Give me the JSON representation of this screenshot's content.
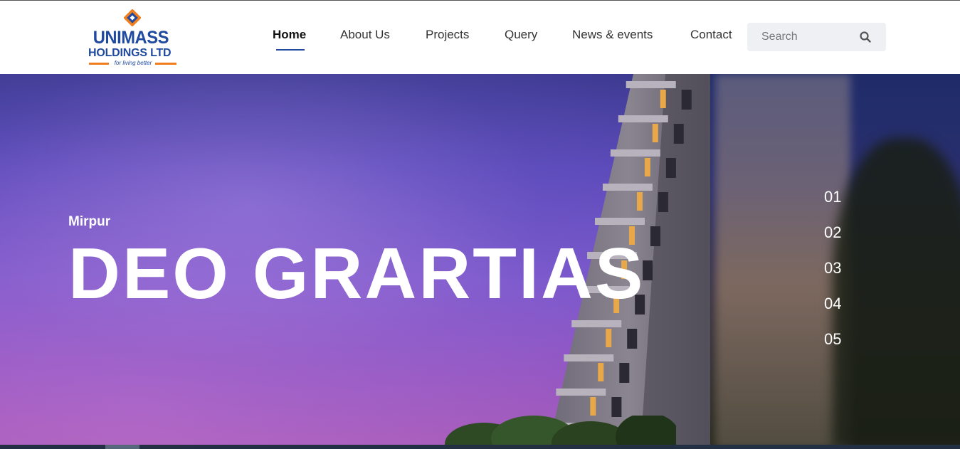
{
  "brand": {
    "name_line1": "UNIMASS",
    "name_line2": "HOLDINGS LTD",
    "tagline": "for living better",
    "colors": {
      "primary": "#1f4aa0",
      "accent": "#f07d1e"
    }
  },
  "nav": {
    "items": [
      {
        "label": "Home",
        "active": true
      },
      {
        "label": "About Us",
        "active": false
      },
      {
        "label": "Projects",
        "active": false
      },
      {
        "label": "Query",
        "active": false
      },
      {
        "label": "News & events",
        "active": false
      },
      {
        "label": "Contact",
        "active": false
      }
    ]
  },
  "search": {
    "placeholder": "Search",
    "value": "",
    "icon": "search-icon"
  },
  "hero": {
    "location": "Mirpur",
    "title": "DEO GRARTIAS",
    "slides": [
      "01",
      "02",
      "03",
      "04",
      "05"
    ]
  }
}
